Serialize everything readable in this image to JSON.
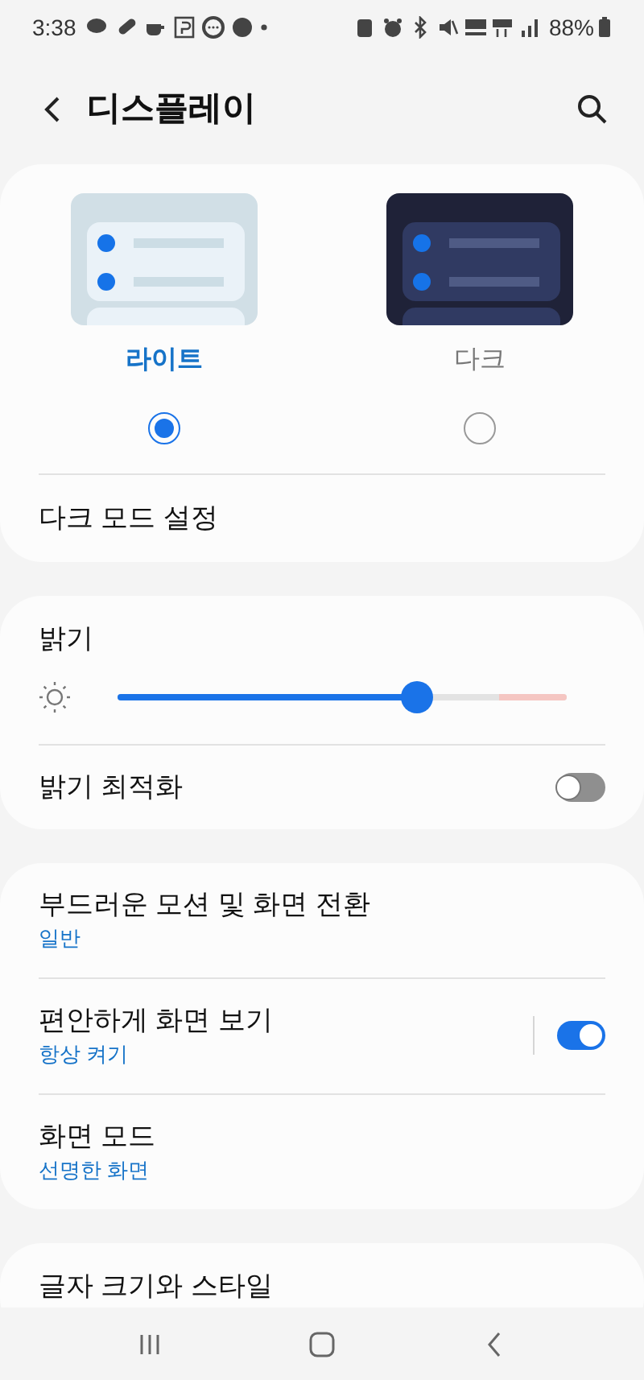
{
  "status_bar": {
    "time": "3:38",
    "battery": "88%"
  },
  "header": {
    "title": "디스플레이"
  },
  "theme_options": [
    {
      "label": "라이트",
      "kind": "light",
      "selected": true
    },
    {
      "label": "다크",
      "kind": "dark",
      "selected": false
    }
  ],
  "dark_mode_settings": {
    "label": "다크 모드 설정"
  },
  "brightness": {
    "label": "밝기",
    "level": 0.68
  },
  "adaptive_brightness": {
    "label": "밝기 최적화",
    "on": false
  },
  "settings": [
    {
      "label": "부드러운 모션 및 화면 전환",
      "value": "일반",
      "kind": "link"
    },
    {
      "label": "편안하게 화면 보기",
      "value": "항상 켜기",
      "kind": "toggle",
      "on": true
    },
    {
      "label": "화면 모드",
      "value": "선명한 화면",
      "kind": "link"
    }
  ],
  "partial_item": {
    "label": "글자 크기와 스타일"
  }
}
